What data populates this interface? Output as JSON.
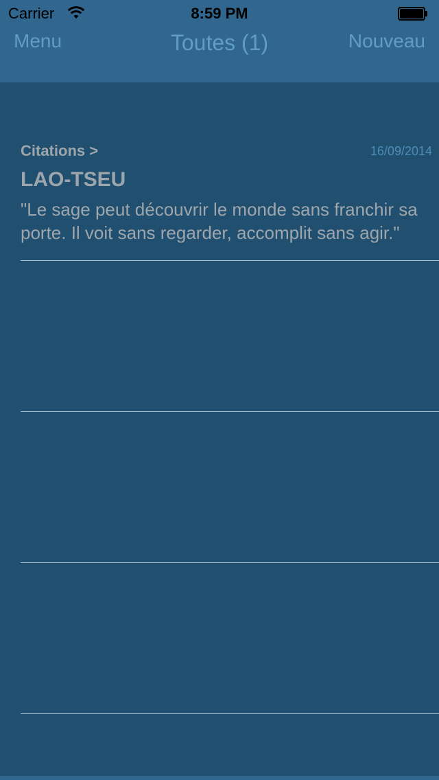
{
  "status_bar": {
    "carrier": "Carrier",
    "time": "8:59 PM",
    "icons": [
      "wifi-icon",
      "battery-icon"
    ]
  },
  "nav_bar": {
    "left_label": "Menu",
    "title": "Toutes (1)",
    "right_label": "Nouveau"
  },
  "list": {
    "items": [
      {
        "category": "Citations >",
        "date": "16/09/2014",
        "author": "LAO-TSEU",
        "quote": "\"Le sage peut découvrir le monde sans franchir sa porte. Il voit sans regarder, accomplit sans agir.\""
      }
    ]
  },
  "colors": {
    "background": "#214f6f",
    "bar": "#31678f",
    "accent": "#5f9dc4",
    "text_muted": "#9ea6ad",
    "separator": "#a9bfcf"
  }
}
